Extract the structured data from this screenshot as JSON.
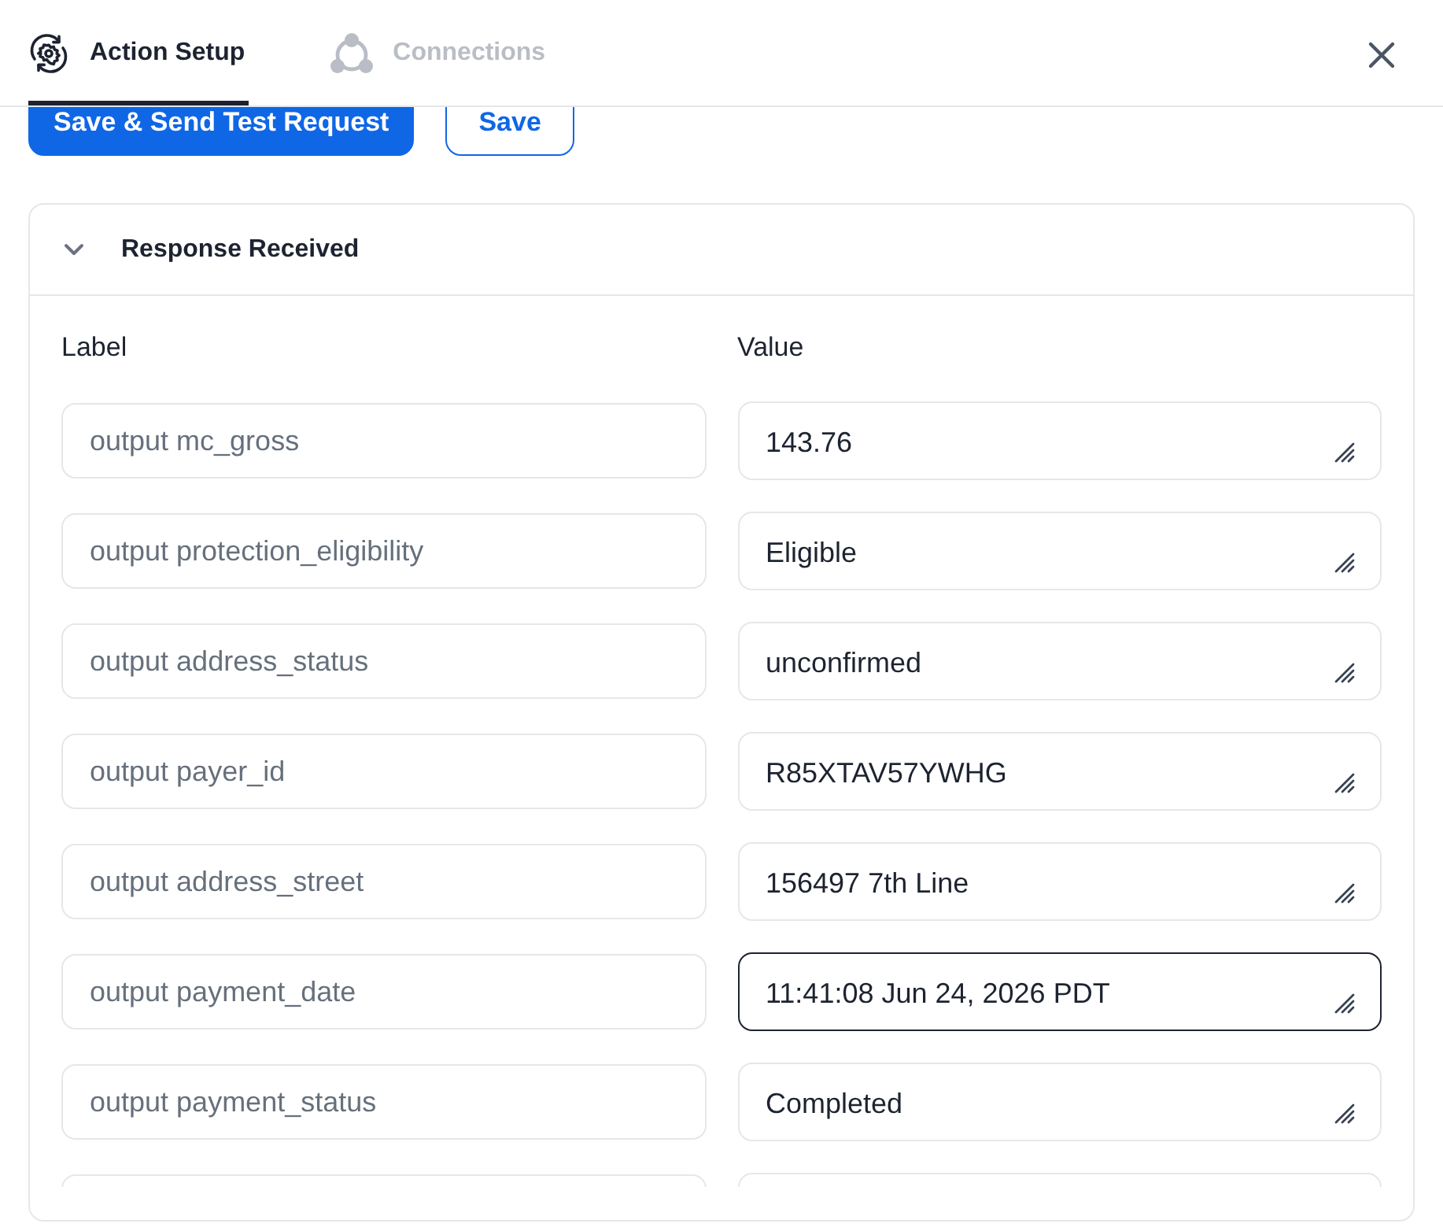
{
  "tabs": [
    {
      "label": "Action Setup",
      "selected": true
    },
    {
      "label": "Connections",
      "selected": false
    }
  ],
  "actions": [
    {
      "label": "Save & Send Test Request",
      "kind": "primary"
    },
    {
      "label": "Save",
      "kind": "secondary"
    }
  ],
  "section": {
    "title": "Response Received",
    "expanded": true,
    "columns": [
      "Label",
      "Value"
    ],
    "rows": [
      {
        "placeholder": "output mc_gross",
        "value": "143.76",
        "focused": false
      },
      {
        "placeholder": "output protection_eligibility",
        "value": "Eligible",
        "focused": false
      },
      {
        "placeholder": "output address_status",
        "value": "unconfirmed",
        "focused": false
      },
      {
        "placeholder": "output payer_id",
        "value": "R85XTAV57YWHG",
        "focused": false
      },
      {
        "placeholder": "output address_street",
        "value": "156497 7th Line",
        "focused": false
      },
      {
        "placeholder": "output payment_date",
        "value": "11:41:08 Jun 24, 2026 PDT",
        "focused": true
      },
      {
        "placeholder": "output payment_status",
        "value": "Completed",
        "focused": false
      },
      {
        "focused": false
      }
    ]
  }
}
